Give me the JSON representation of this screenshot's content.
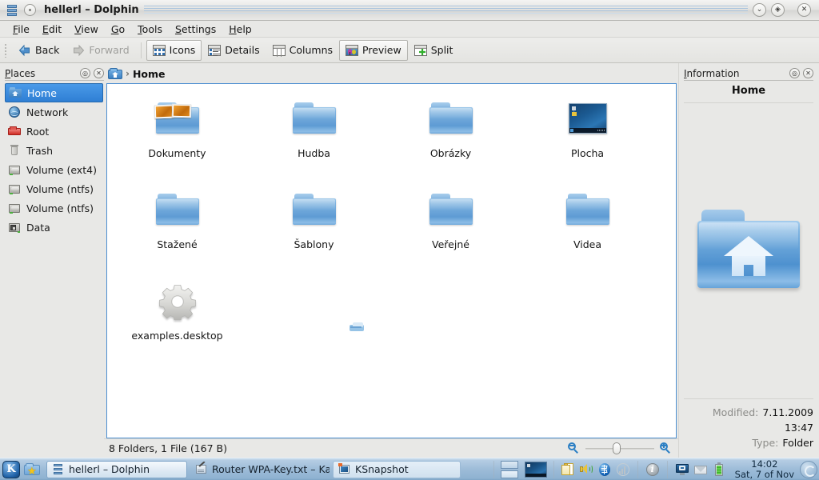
{
  "window": {
    "title": "hellerl – Dolphin",
    "app_icon": "dolphin-drawers-icon",
    "buttons": {
      "menu_label": "·",
      "minimize": "⌄",
      "maximize": "◈",
      "close": "✕"
    }
  },
  "menubar": {
    "items": [
      {
        "label": "File",
        "accel": "F"
      },
      {
        "label": "Edit",
        "accel": "E"
      },
      {
        "label": "View",
        "accel": "V"
      },
      {
        "label": "Go",
        "accel": "G"
      },
      {
        "label": "Tools",
        "accel": "T"
      },
      {
        "label": "Settings",
        "accel": "S"
      },
      {
        "label": "Help",
        "accel": "H"
      }
    ]
  },
  "toolbar": {
    "back": "Back",
    "forward": "Forward",
    "icons": "Icons",
    "details": "Details",
    "columns": "Columns",
    "preview": "Preview",
    "split": "Split"
  },
  "places": {
    "title": "Places",
    "title_accel": "P",
    "config_button": "◎",
    "close_button": "✕",
    "items": [
      {
        "label": "Home",
        "icon": "home-folder-icon",
        "selected": true
      },
      {
        "label": "Network",
        "icon": "network-globe-icon",
        "selected": false
      },
      {
        "label": "Root",
        "icon": "red-folder-icon",
        "selected": false
      },
      {
        "label": "Trash",
        "icon": "trash-can-icon",
        "selected": false
      },
      {
        "label": "Volume (ext4)",
        "icon": "hard-drive-icon",
        "selected": false
      },
      {
        "label": "Volume (ntfs)",
        "icon": "hard-drive-icon",
        "selected": false
      },
      {
        "label": "Volume (ntfs)",
        "icon": "hard-drive-icon",
        "selected": false
      },
      {
        "label": "Data",
        "icon": "data-drive-icon",
        "selected": false
      }
    ]
  },
  "breadcrumb": {
    "home_icon": "home-folder-icon",
    "separator": "›",
    "current": "Home"
  },
  "files": [
    {
      "name": "Dokumenty",
      "icon": "folder-with-document-thumbnails"
    },
    {
      "name": "Hudba",
      "icon": "folder-icon"
    },
    {
      "name": "Obrázky",
      "icon": "folder-icon"
    },
    {
      "name": "Plocha",
      "icon": "folder-desktop-screenshot-thumbnail"
    },
    {
      "name": "Stažené",
      "icon": "folder-icon"
    },
    {
      "name": "Šablony",
      "icon": "folder-icon"
    },
    {
      "name": "Veřejné",
      "icon": "folder-icon"
    },
    {
      "name": "Videa",
      "icon": "folder-icon"
    },
    {
      "name": "examples.desktop",
      "icon": "gear-icon"
    }
  ],
  "statusbar": {
    "summary": "8 Folders, 1 File (167 B)",
    "zoom_out_icon": "zoom-out-magnifier-icon",
    "zoom_in_icon": "zoom-in-magnifier-icon",
    "zoom_value": 45
  },
  "info_panel": {
    "title": "Information",
    "title_accel": "I",
    "config_button": "◎",
    "close_button": "✕",
    "name": "Home",
    "preview_icon": "home-folder-large-icon",
    "meta": [
      {
        "key": "Modified:",
        "value": "7.11.2009"
      },
      {
        "key": "",
        "value": "13:47"
      },
      {
        "key": "Type:",
        "value": "Folder"
      }
    ]
  },
  "taskbar": {
    "kmenu_label": "K",
    "favorites_icon": "folder-star-icon",
    "tasks": [
      {
        "label": "hellerl – Dolphin",
        "icon": "dolphin-drawers-icon",
        "active": true
      },
      {
        "label": "Router WPA-Key.txt – Kate",
        "icon": "kate-editor-icon",
        "active": false
      },
      {
        "label": "KSnapshot",
        "icon": "ksnapshot-icon",
        "active": false
      }
    ],
    "pager": [
      "desktop-1",
      "desktop-2"
    ],
    "desktop_preview_icon": "desktop-preview-icon",
    "tray": [
      "klipper-clipboard-icon",
      "volume-speaker-icon",
      "bluetooth-icon",
      "wifi-signal-icon",
      "info-icon",
      "network-monitor-icon",
      "mail-envelope-icon",
      "battery-icon"
    ],
    "clock": {
      "time": "14:02",
      "date": "Sat, 7 of Nov"
    },
    "show_desktop_icon": "show-desktop-icon"
  },
  "colors": {
    "selection_blue": "#2f7fd4",
    "view_border": "#4d8fd1",
    "window_bg": "#e8e8e6",
    "taskbar_blue": "#9dbcd8",
    "desktop_bg": "#5a7fa8"
  }
}
